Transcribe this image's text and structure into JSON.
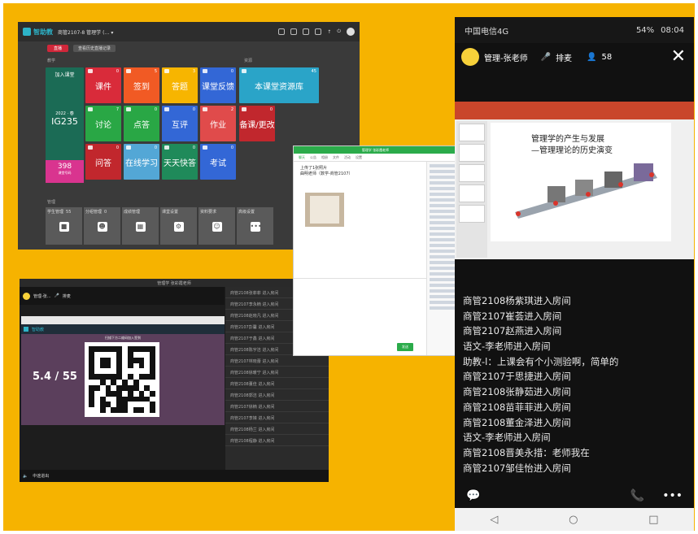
{
  "windowA": {
    "brand": "智助教",
    "course_selector": "商管2107-8 管理学 (… ▾",
    "live_button": "直播",
    "history_button": "查看历史直播记录",
    "section_teach": "教学",
    "section_resource": "资源",
    "section_manage": "管理",
    "join_class": "加入课堂",
    "class_date": "2022 · 春",
    "class_code": "IG235",
    "class_count": "398",
    "class_count_label": "课堂号码",
    "tiles": [
      {
        "label": "课件",
        "num": "0",
        "color": "#d92b3a"
      },
      {
        "label": "签到",
        "num": "5",
        "color": "#f15a24"
      },
      {
        "label": "答题",
        "num": "3",
        "color": "#f7b500"
      },
      {
        "label": "课堂反馈",
        "num": "0",
        "color": "#3367d6"
      },
      {
        "label": "本课堂资源库",
        "num": "45",
        "color": "#2aa4c8"
      },
      {
        "label": "讨论",
        "num": "7",
        "color": "#29a745"
      },
      {
        "label": "点答",
        "num": "0",
        "color": "#29a745"
      },
      {
        "label": "互评",
        "num": "0",
        "color": "#3367d6"
      },
      {
        "label": "作业",
        "num": "2",
        "color": "#e04b4b"
      },
      {
        "label": "备课/更改",
        "num": "0",
        "color": "#c1272d"
      },
      {
        "label": "问答",
        "num": "0",
        "color": "#c1272d"
      },
      {
        "label": "在线学习",
        "num": "0",
        "color": "#53a7d6"
      },
      {
        "label": "天天快答",
        "num": "0",
        "color": "#1f8a5a"
      },
      {
        "label": "考试",
        "num": "0",
        "color": "#3367d6"
      }
    ],
    "manage": [
      {
        "label": "学生管理",
        "num": "55",
        "icon": "■"
      },
      {
        "label": "分组管理",
        "num": "0",
        "icon": "☻"
      },
      {
        "label": "成绩管理",
        "num": "",
        "icon": "▦"
      },
      {
        "label": "课堂设置",
        "num": "",
        "icon": "⚙"
      },
      {
        "label": "资料要求",
        "num": "",
        "icon": "☺"
      },
      {
        "label": "高级设置",
        "num": "",
        "icon": "•••"
      }
    ]
  },
  "windowB": {
    "title": "管理学 张彩霞老师",
    "header_name": "管理-张...",
    "header_mic": "排麦",
    "inner_title": "扫描下方二维码加入签到",
    "score": "5.4 / 55",
    "chat": [
      "商管2108张菲菲 进入房间",
      "商管2107李永楠 进入房间",
      "商管2108赵晓凡 进入房间",
      "商管2107彭馨 进入房间",
      "商管2107于鑫 进入房间",
      "商管2108陈宇洁 进入房间",
      "商管2107林晓蕾 进入房间",
      "商管2108徐暖宁 进入房间",
      "商管2108董佳 进入房间",
      "商管2108郭洁 进入房间",
      "商管2107徐楠 进入房间",
      "商管2107李婧 进入房间",
      "商管2108杨兰 进入房间",
      "商管2108程静 进入房间"
    ],
    "footer": "中途进出"
  },
  "windowC": {
    "title": "管理学 张彩霞老师",
    "tabs": [
      "聊天",
      "公告",
      "相册",
      "文件",
      "活动",
      "设置"
    ],
    "msg1": "上传了1张照片",
    "msg2": "曲明老师（数学-商管2107）",
    "send": "发送"
  },
  "phone": {
    "carrier": "中国电信4G",
    "battery": "54%",
    "time": "08:04",
    "room_name": "管理-张老师",
    "mic_label": "排麦",
    "viewers": "58",
    "slide_title_1": "管理学的产生与发展",
    "slide_title_2": "—管理理论的历史演变",
    "chat": [
      "商管2108杨紫琪进入房间",
      "商管2107崔荟进入房间",
      "商管2107赵燕进入房间",
      "语文-李老师进入房间",
      "助教-l：上课会有个小测验啊，简单的",
      "商管2107于思捷进入房间",
      "商管2108张静茹进入房间",
      "商管2108苗菲菲进入房间",
      "商管2108董金泽进入房间",
      "语文-李老师进入房间",
      "商管2108晋美永措：老师我在",
      "商管2107邹佳怡进入房间"
    ]
  }
}
